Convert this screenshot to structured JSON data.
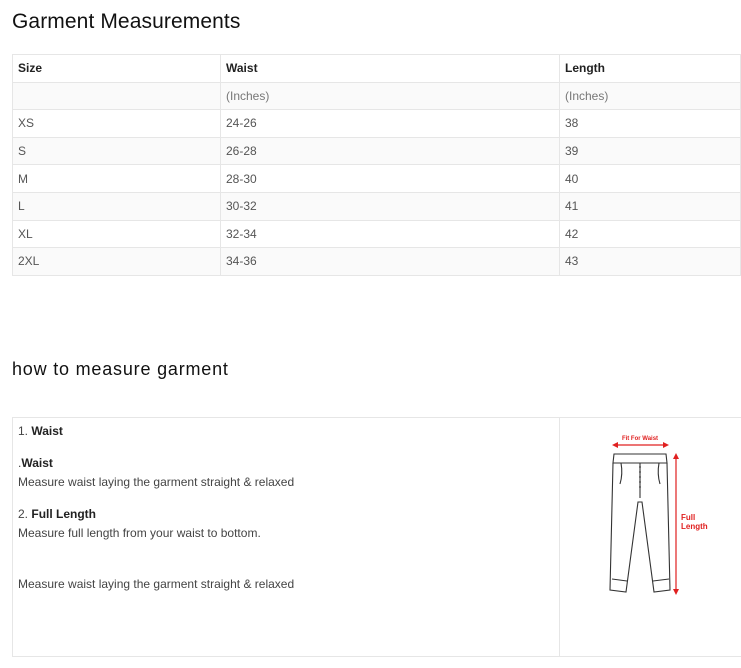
{
  "page": {
    "title": "Garment Measurements",
    "section_title": "how to measure garment"
  },
  "size_table": {
    "headers": [
      "Size",
      "Waist",
      "Length"
    ],
    "units": [
      "",
      "(Inches)",
      "(Inches)"
    ],
    "rows": [
      [
        "XS",
        "24-26",
        "38"
      ],
      [
        "S",
        "26-28",
        "39"
      ],
      [
        "M",
        "28-30",
        "40"
      ],
      [
        "L",
        "30-32",
        "41"
      ],
      [
        "XL",
        "32-34",
        "42"
      ],
      [
        "2XL",
        "34-36",
        "43"
      ]
    ]
  },
  "instructions": {
    "item1_number": "1.",
    "item1_label": "Waist",
    "waist_prefix": ".",
    "waist_label": "Waist",
    "waist_text": "Measure waist laying the garment straight & relaxed",
    "item2_number": "2.",
    "item2_label": "Full Length",
    "length_text": "Measure full length from your waist to bottom.",
    "extra_text": "Measure waist laying the garment straight & relaxed"
  },
  "diagram": {
    "waist_label": "Fit For Waist",
    "length_label_1": "Full",
    "length_label_2": "Length",
    "accent_color": "#e02020",
    "outline_color": "#333333"
  }
}
